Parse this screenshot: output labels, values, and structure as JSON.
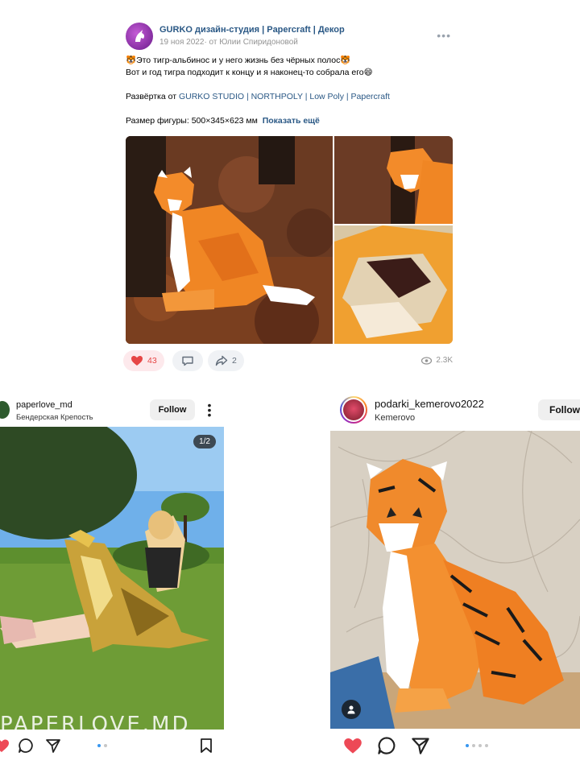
{
  "vk_post": {
    "group_name": "GURKO дизайн-студия | Papercraft | Декор",
    "date": "19 ноя 2022",
    "author_prefix": "· от ",
    "author": "Юлии Спиридоновой",
    "line1": "🐯Это тигр-альбинос и у него жизнь без чёрных полос🐯",
    "line2": "Вот и год тигра подходит к концу и я наконец-то собрала его😄",
    "line3_prefix": "Развёртка от ",
    "line3_link": "GURKO STUDIO | NORTHPOLY | Low Poly | Papercraft",
    "line4": "Размер фигуры: 500×345×623 мм",
    "show_more": "Показать ещё",
    "likes": "43",
    "shares": "2",
    "views": "2.3K",
    "colors": {
      "link": "#2a5885",
      "like": "#e64646"
    }
  },
  "ig_left": {
    "username": "paperlove_md",
    "location": "Бендерская Крепость",
    "follow_label": "Follow",
    "counter": "1/2",
    "watermark": "PAPERLOVE.MD"
  },
  "ig_right": {
    "username": "podarki_kemerovo2022",
    "location": "Kemerovo",
    "follow_label": "Follow"
  },
  "icons": [
    "more-icon",
    "heart-icon",
    "comment-icon",
    "share-icon",
    "eye-icon",
    "kebab-icon",
    "send-icon",
    "bookmark-icon",
    "person-tag-icon"
  ]
}
